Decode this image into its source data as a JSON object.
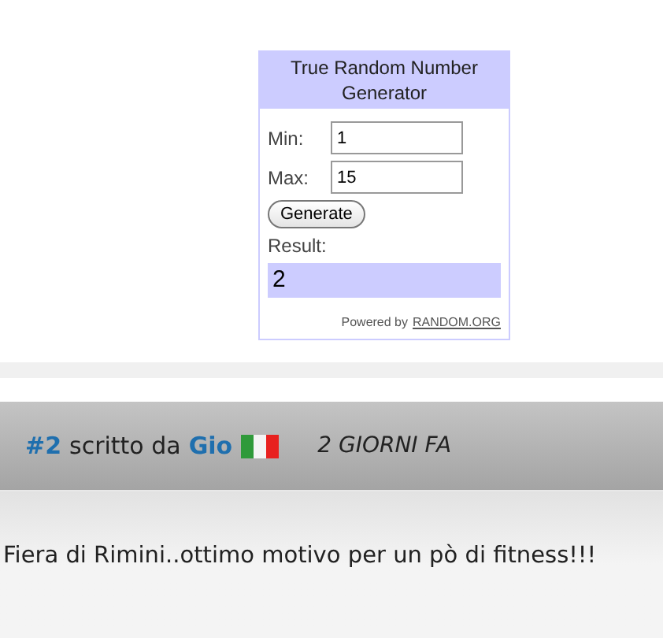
{
  "widget": {
    "title": "True Random Number Generator",
    "min_label": "Min:",
    "min_value": "1",
    "max_label": "Max:",
    "max_value": "15",
    "button": "Generate",
    "result_label": "Result:",
    "result": "2",
    "powered_by": "Powered by",
    "powered_link": "RANDOM.ORG"
  },
  "comment": {
    "number": "#2",
    "written_by": "scritto da",
    "author": "Gio",
    "time": "2 GIORNI FA",
    "text": "Fiera di Rimini..ottimo motivo per un pò di fitness!!!"
  }
}
